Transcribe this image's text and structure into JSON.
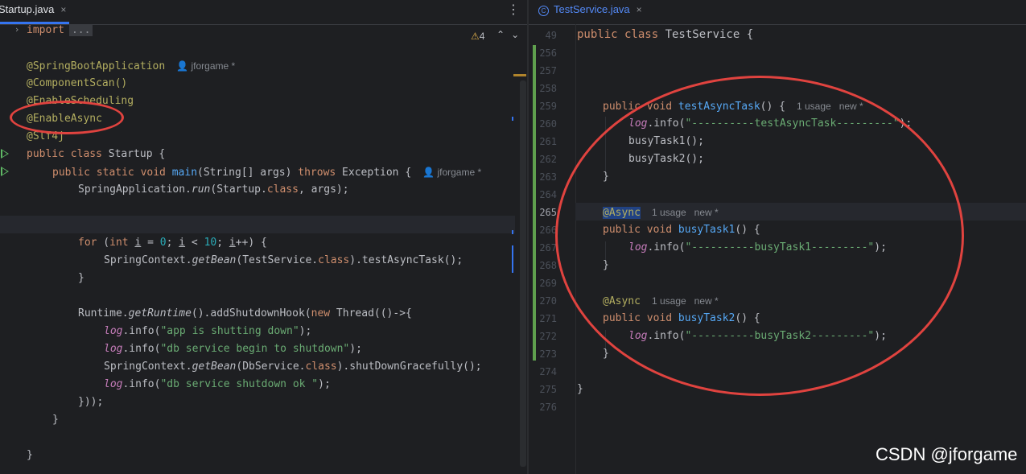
{
  "left_tab": {
    "label": "Startup.java",
    "close": "×"
  },
  "right_tab": {
    "label": "TestService.java",
    "close": "×",
    "icon": "class-icon",
    "icon_glyph": "C"
  },
  "more_menu_glyph": "⋮",
  "inspection": {
    "count": "4",
    "warn_glyph": "⚠",
    "nav_up": "⌃",
    "nav_down": "⌄"
  },
  "left_editor": {
    "fold_arrow": "›",
    "import_kw": "import",
    "import_dots": "...",
    "annotations": {
      "spring_boot": "@SpringBootApplication",
      "component_scan": "@ComponentScan()",
      "enable_scheduling": "@EnableScheduling",
      "enable_async": "@EnableAsync",
      "slf4j": "@Slf4j"
    },
    "author_hint": "jforgame *",
    "class_decl": {
      "kw": "public class ",
      "name": "Startup {"
    },
    "main_decl": {
      "kw": "public static void ",
      "fn": "main",
      "args": "(String[] args) ",
      "throws": "throws",
      "exc": " Exception {"
    },
    "run_line": {
      "a": "SpringApplication.",
      "b": "run",
      "c": "(Startup.",
      "d": "class",
      "e": ", args);"
    },
    "for_line": {
      "kw1": "for",
      "a": " (",
      "kw2": "int",
      "b": " ",
      "v1": "i",
      "c": " = ",
      "n1": "0",
      "d": "; ",
      "v2": "i",
      "e": " < ",
      "n2": "10",
      "f": "; ",
      "v3": "i",
      "g": "++) {"
    },
    "getbean_line": {
      "a": "SpringContext.",
      "b": "getBean",
      "c": "(TestService.",
      "d": "class",
      "e": ").testAsyncTask();"
    },
    "close_brace": "}",
    "runtime_line": {
      "a": "Runtime.",
      "b": "getRuntime",
      "c": "().addShutdownHook(",
      "d": "new",
      "e": " Thread(()->{"
    },
    "log1": {
      "log": "log",
      "a": ".info(",
      "s": "\"app is shutting down\"",
      "b": ");"
    },
    "log2": {
      "log": "log",
      "a": ".info(",
      "s": "\"db service begin to shutdown\"",
      "b": ");"
    },
    "shutdown_line": {
      "a": "SpringContext.",
      "b": "getBean",
      "c": "(DbService.",
      "d": "class",
      "e": ").shutDownGracefully();"
    },
    "log3": {
      "log": "log",
      "a": ".info(",
      "s": "\"db service shutdown ok \"",
      "b": ");"
    },
    "close_thread": "}));",
    "close_method": "}",
    "close_class": "}"
  },
  "right_editor": {
    "header_line": {
      "num": "49",
      "kw": "public class ",
      "name": "TestService {"
    },
    "line_numbers": [
      "256",
      "257",
      "258",
      "259",
      "260",
      "261",
      "262",
      "263",
      "264",
      "265",
      "266",
      "267",
      "268",
      "269",
      "270",
      "271",
      "272",
      "273",
      "274",
      "275",
      "276"
    ],
    "test_async": {
      "kw": "public void ",
      "fn": "testAsyncTask",
      "rest": "() {",
      "hint": "1 usage   new *"
    },
    "log_test": {
      "log": "log",
      "a": ".info(",
      "s": "\"----------testAsyncTask---------\"",
      "b": ");"
    },
    "busy1_call": "busyTask1();",
    "busy2_call": "busyTask2();",
    "async_ann": "@Async",
    "async_hint": "1 usage   new *",
    "busy1_decl": {
      "kw": "public void ",
      "fn": "busyTask1",
      "rest": "() {"
    },
    "log_b1": {
      "log": "log",
      "a": ".info(",
      "s": "\"----------busyTask1---------\"",
      "b": ");"
    },
    "busy2_decl": {
      "kw": "public void ",
      "fn": "busyTask2",
      "rest": "() {"
    },
    "log_b2": {
      "log": "log",
      "a": ".info(",
      "s": "\"----------busyTask2---------\"",
      "b": ");"
    },
    "close_brace": "}"
  },
  "watermark": "CSDN @jforgame",
  "colors": {
    "keyword": "#cf8e6d",
    "annotation": "#b3ae60",
    "function": "#56a8f5",
    "string": "#6aab73",
    "number": "#2aacb8",
    "accent": "#3574f0",
    "circle": "#e0433f"
  }
}
